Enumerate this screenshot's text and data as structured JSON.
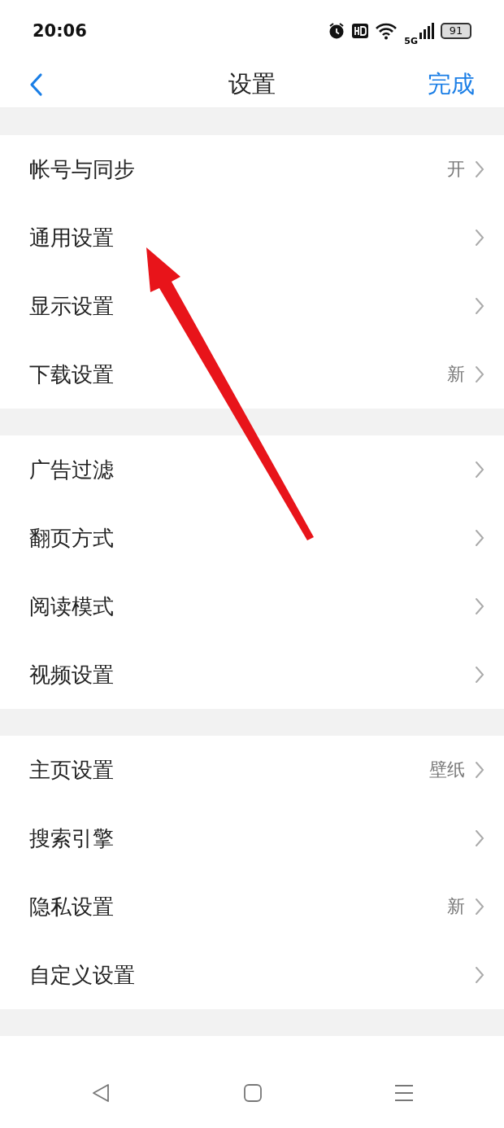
{
  "status_bar": {
    "time": "20:06",
    "battery": "91",
    "network": "5G"
  },
  "header": {
    "title": "设置",
    "done": "完成"
  },
  "sections": [
    {
      "items": [
        {
          "label": "帐号与同步",
          "value": "开"
        },
        {
          "label": "通用设置"
        },
        {
          "label": "显示设置"
        },
        {
          "label": "下载设置",
          "value": "新"
        }
      ]
    },
    {
      "items": [
        {
          "label": "广告过滤"
        },
        {
          "label": "翻页方式"
        },
        {
          "label": "阅读模式"
        },
        {
          "label": "视频设置"
        }
      ]
    },
    {
      "items": [
        {
          "label": "主页设置",
          "value": "壁纸"
        },
        {
          "label": "搜索引擎"
        },
        {
          "label": "隐私设置",
          "value": "新"
        },
        {
          "label": "自定义设置"
        }
      ]
    }
  ]
}
